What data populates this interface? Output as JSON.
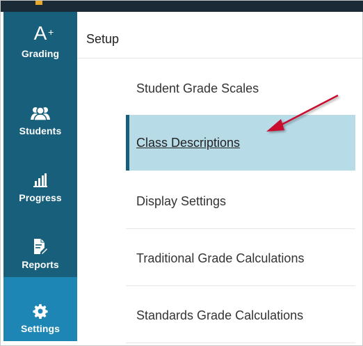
{
  "sidebar": {
    "items": [
      {
        "label": "Grading",
        "icon": "grade-a-plus-icon",
        "active": false
      },
      {
        "label": "Students",
        "icon": "students-icon",
        "active": false
      },
      {
        "label": "Progress",
        "icon": "progress-chart-icon",
        "active": false
      },
      {
        "label": "Reports",
        "icon": "report-edit-icon",
        "active": false
      },
      {
        "label": "Settings",
        "icon": "gear-icon",
        "active": true
      }
    ],
    "grading_glyph": "A",
    "grading_sup": "+"
  },
  "content": {
    "title": "Setup",
    "menu": [
      {
        "label": "Student Grade Scales"
      },
      {
        "label": "Class Descriptions",
        "selected": true
      },
      {
        "label": "Display Settings"
      },
      {
        "label": "Traditional Grade Calculations"
      },
      {
        "label": "Standards Grade Calculations"
      }
    ]
  },
  "colors": {
    "sidebar": "#175f7a",
    "sidebar_active": "#1e86b4",
    "selected_row": "#b8dbe8",
    "arrow": "#c8102e",
    "topbar": "#1a2a36"
  }
}
